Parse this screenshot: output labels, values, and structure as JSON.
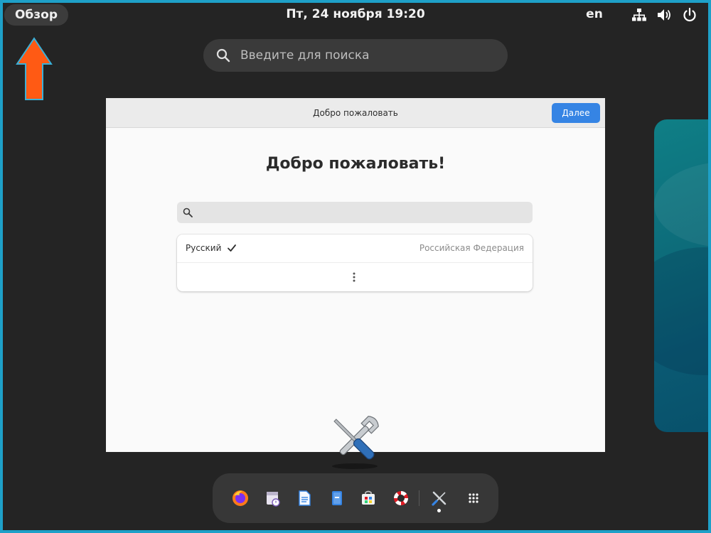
{
  "topbar": {
    "activities_label": "Обзор",
    "clock": "Пт, 24 ноября  19:20",
    "keyboard_layout": "en"
  },
  "search": {
    "placeholder": "Введите для поиска"
  },
  "window": {
    "title": "Добро пожаловать",
    "next_button_label": "Далее",
    "heading": "Добро пожаловать!",
    "language_list": [
      {
        "language": "Русский",
        "region": "Российская Федерация",
        "selected": true
      }
    ]
  },
  "dock": {
    "items": [
      "firefox-icon",
      "calendar-app-icon",
      "text-editor-icon",
      "files-icon",
      "software-icon",
      "help-icon",
      "tools-icon",
      "app-grid-icon"
    ]
  },
  "colors": {
    "accent": "#3584e4",
    "arrow": "#ff5a14",
    "frame": "#1ea0c8"
  }
}
